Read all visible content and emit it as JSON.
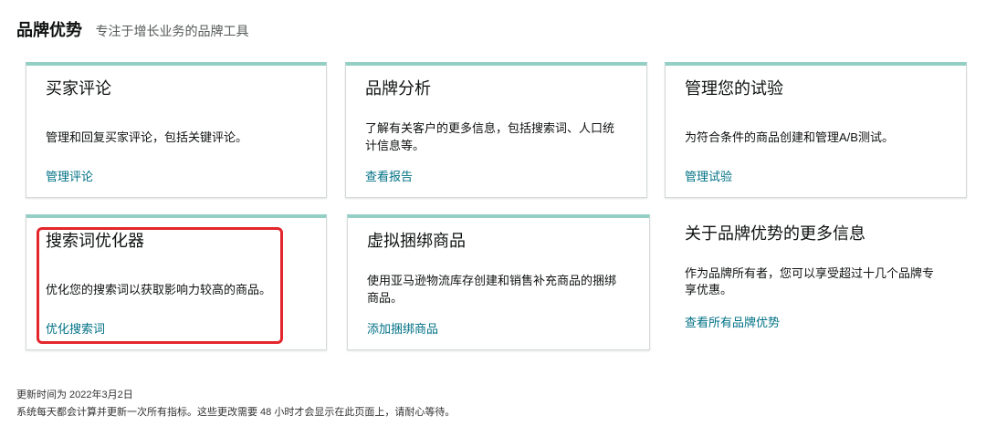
{
  "header": {
    "title": "品牌优势",
    "subtitle": "专注于增长业务的品牌工具"
  },
  "cards": [
    {
      "title": "买家评论",
      "description": "管理和回复买家评论，包括关键评论。",
      "link": "管理评论"
    },
    {
      "title": "品牌分析",
      "description": "了解有关客户的更多信息，包括搜索词、人口统计信息等。",
      "link": "查看报告"
    },
    {
      "title": "管理您的试验",
      "description": "为符合条件的商品创建和管理A/B测试。",
      "link": "管理试验"
    },
    {
      "title": "搜索词优化器",
      "description": "优化您的搜索词以获取影响力较高的商品。",
      "link": "优化搜索词"
    },
    {
      "title": "虚拟捆绑商品",
      "description": "使用亚马逊物流库存创建和销售补充商品的捆绑商品。",
      "link": "添加捆绑商品"
    }
  ],
  "more_info": {
    "title": "关于品牌优势的更多信息",
    "description": "作为品牌所有者，您可以享受超过十几个品牌专享优惠。",
    "link": "查看所有品牌优势"
  },
  "footer": {
    "updated": "更新时间为 2022年3月2日",
    "note": "系统每天都会计算并更新一次所有指标。这些更改需要 48 小时才会显示在此页面上，请耐心等待。"
  },
  "colors": {
    "accent": "#94cfc6",
    "link": "#007185",
    "highlight": "#e3262c",
    "text": "#0f1111"
  }
}
